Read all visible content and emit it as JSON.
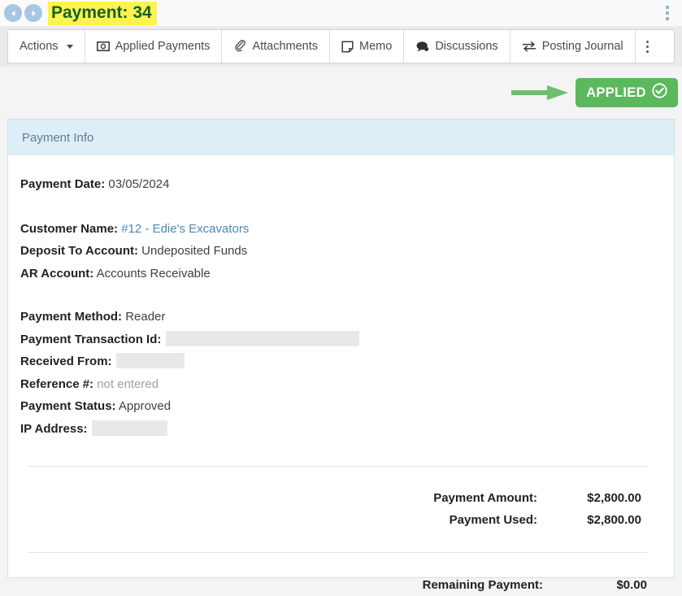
{
  "titlebar": {
    "back_icon": "arrow-left-circle-icon",
    "forward_icon": "arrow-right-circle-icon",
    "title": "Payment: 34",
    "menu_icon": "vertical-dots-icon"
  },
  "toolbar": {
    "items": [
      {
        "label": "Actions",
        "icon": "none",
        "caret": true
      },
      {
        "label": "Applied Payments",
        "icon": "money-bill-icon",
        "caret": false
      },
      {
        "label": "Attachments",
        "icon": "paperclip-icon",
        "caret": false
      },
      {
        "label": "Memo",
        "icon": "note-icon",
        "caret": false
      },
      {
        "label": "Discussions",
        "icon": "comment-icon",
        "caret": false
      },
      {
        "label": "Posting Journal",
        "icon": "exchange-arrows-icon",
        "caret": false
      }
    ],
    "overflow_icon": "vertical-dots-icon"
  },
  "status": {
    "annotation_icon": "green-arrow-icon",
    "badge_label": "APPLIED",
    "badge_icon": "check-circle-icon",
    "badge_color": "#5cb85c",
    "annotation_color": "#6cbf6c"
  },
  "panel": {
    "header": "Payment Info",
    "fields": {
      "payment_date_label": "Payment Date:",
      "payment_date_value": "03/05/2024",
      "customer_name_label": "Customer Name:",
      "customer_name_value": "#12 - Edie's Excavators",
      "deposit_to_account_label": "Deposit To Account:",
      "deposit_to_account_value": "Undeposited Funds",
      "ar_account_label": "AR Account:",
      "ar_account_value": "Accounts Receivable",
      "payment_method_label": "Payment Method:",
      "payment_method_value": "Reader",
      "payment_transaction_id_label": "Payment Transaction Id:",
      "payment_transaction_id_value": "",
      "received_from_label": "Received From:",
      "received_from_value": "",
      "reference_label": "Reference #:",
      "reference_value": "not entered",
      "payment_status_label": "Payment Status:",
      "payment_status_value": "Approved",
      "ip_address_label": "IP Address:",
      "ip_address_value": ""
    },
    "totals": [
      {
        "label": "Payment Amount:",
        "value": "$2,800.00"
      },
      {
        "label": "Payment Used:",
        "value": "$2,800.00"
      }
    ],
    "remaining": {
      "label": "Remaining Payment:",
      "value": "$0.00"
    }
  }
}
